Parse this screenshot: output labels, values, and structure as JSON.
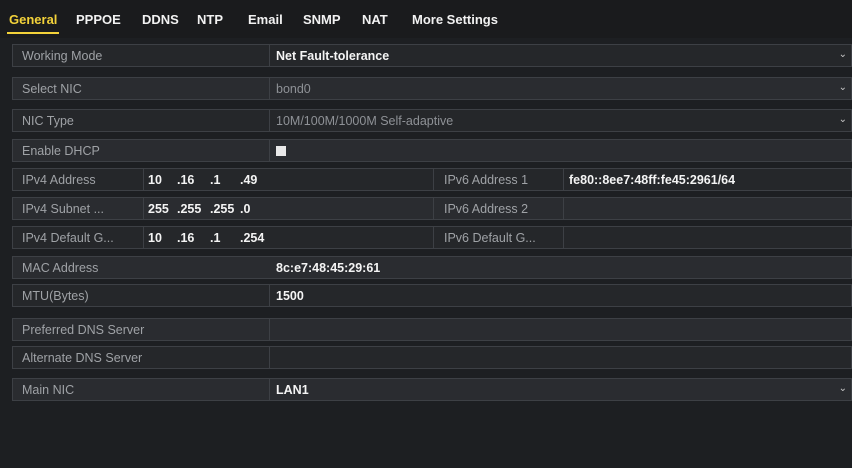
{
  "tabs": [
    "General",
    "PPPOE",
    "DDNS",
    "NTP",
    "Email",
    "SNMP",
    "NAT",
    "More Settings"
  ],
  "fields": {
    "working_mode": {
      "label": "Working Mode",
      "value": "Net Fault-tolerance"
    },
    "select_nic": {
      "label": "Select NIC",
      "value": "bond0"
    },
    "nic_type": {
      "label": "NIC Type",
      "value": "10M/100M/1000M Self-adaptive"
    },
    "enable_dhcp": {
      "label": "Enable DHCP",
      "checked": true
    },
    "ipv4_address": {
      "label": "IPv4 Address",
      "octets": [
        "10",
        ".16",
        ".1",
        ".49"
      ]
    },
    "ipv4_subnet": {
      "label": "IPv4 Subnet ...",
      "octets": [
        "255",
        ".255",
        ".255",
        ".0"
      ]
    },
    "ipv4_gateway": {
      "label": "IPv4 Default G...",
      "octets": [
        "10",
        ".16",
        ".1",
        ".254"
      ]
    },
    "ipv6_address_1": {
      "label": "IPv6 Address 1",
      "value": "fe80::8ee7:48ff:fe45:2961/64"
    },
    "ipv6_address_2": {
      "label": "IPv6 Address 2",
      "value": ""
    },
    "ipv6_gateway": {
      "label": "IPv6 Default G...",
      "value": ""
    },
    "mac_address": {
      "label": "MAC Address",
      "value": "8c:e7:48:45:29:61"
    },
    "mtu": {
      "label": "MTU(Bytes)",
      "value": "1500"
    },
    "preferred_dns": {
      "label": "Preferred DNS Server",
      "value": ""
    },
    "alternate_dns": {
      "label": "Alternate DNS Server",
      "value": ""
    },
    "main_nic": {
      "label": "Main NIC",
      "value": "LAN1"
    }
  },
  "colors": {
    "accent": "#f3d23a",
    "background": "#1d1f22"
  },
  "icons": {
    "dropdown": "chevron-down-icon"
  }
}
